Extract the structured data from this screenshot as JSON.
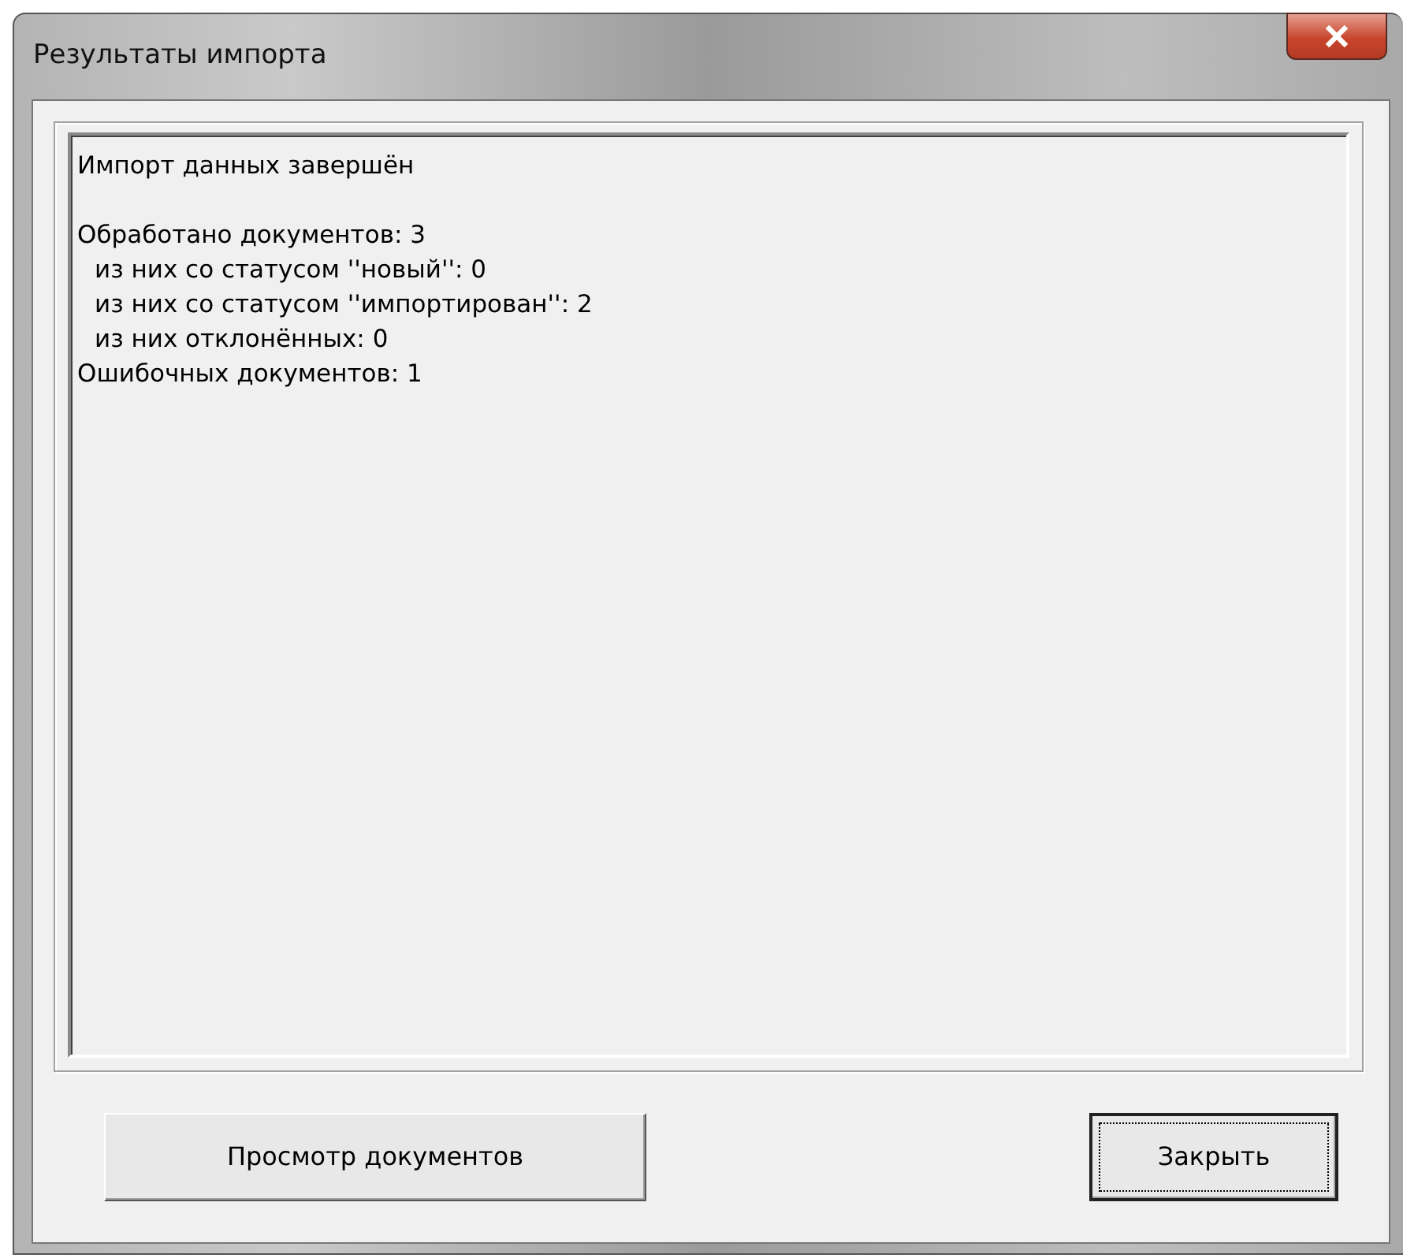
{
  "window": {
    "title": "Результаты импорта"
  },
  "report": {
    "paragraphs": [
      {
        "lines": [
          {
            "text": "Импорт данных завершён"
          }
        ]
      },
      {
        "lines": [
          {
            "text": "Обработано документов: 3",
            "children": [
              {
                "text": "из них со статусом ''новый'': 0"
              },
              {
                "text": "из них со статусом ''импортирован'': 2"
              },
              {
                "text": "из них отклонённых: 0"
              }
            ]
          },
          {
            "text": "Ошибочных документов: 1"
          }
        ]
      }
    ]
  },
  "buttons": [
    {
      "label": "Просмотр документов",
      "focused": false
    },
    {
      "label": "Закрыть",
      "focused": true
    }
  ]
}
